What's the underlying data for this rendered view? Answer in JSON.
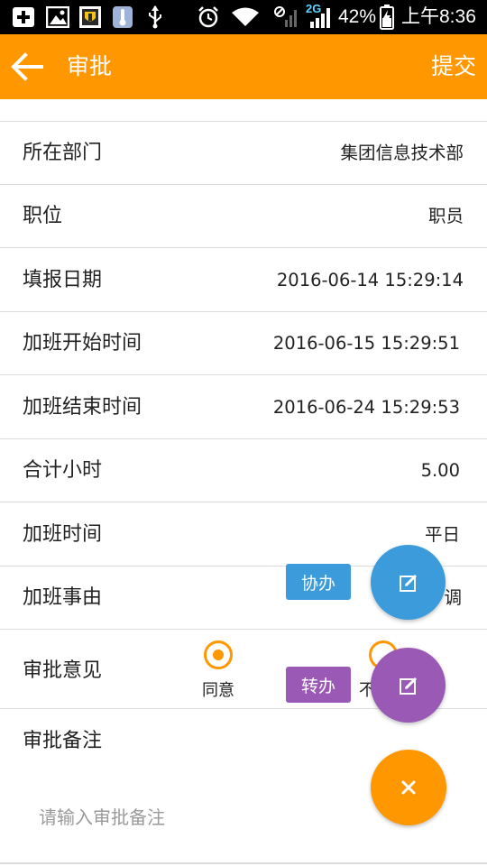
{
  "status_bar": {
    "network_label": "2G",
    "battery_percent": "42%",
    "time": "上午8:36"
  },
  "app_bar": {
    "title": "审批",
    "submit_label": "提交"
  },
  "form": {
    "rows": [
      {
        "label": "所在部门",
        "value": "集团信息技术部"
      },
      {
        "label": "职位",
        "value": "职员"
      },
      {
        "label": "填报日期",
        "value": "2016-06-14 15:29:14"
      },
      {
        "label": "加班开始时间",
        "value": "2016-06-15 15:29:51"
      },
      {
        "label": "加班结束时间",
        "value": "2016-06-24 15:29:53"
      },
      {
        "label": "合计小时",
        "value": "5.00"
      },
      {
        "label": "加班时间",
        "value": "平日"
      },
      {
        "label": "加班事由",
        "value": "调"
      }
    ],
    "opinion": {
      "label": "审批意见",
      "options": [
        {
          "label": "同意",
          "selected": true
        },
        {
          "label": "不",
          "selected": false
        }
      ]
    },
    "remark": {
      "label": "审批备注",
      "placeholder": "请输入审批备注"
    }
  },
  "fab_menu": {
    "assist_label": "协办",
    "transfer_label": "转办",
    "colors": {
      "assist": "#3B9BDB",
      "transfer": "#9B59B6",
      "close": "#FF9800"
    }
  },
  "icons": {
    "back": "arrow-left-icon",
    "edit": "edit-icon",
    "close": "close-icon"
  }
}
